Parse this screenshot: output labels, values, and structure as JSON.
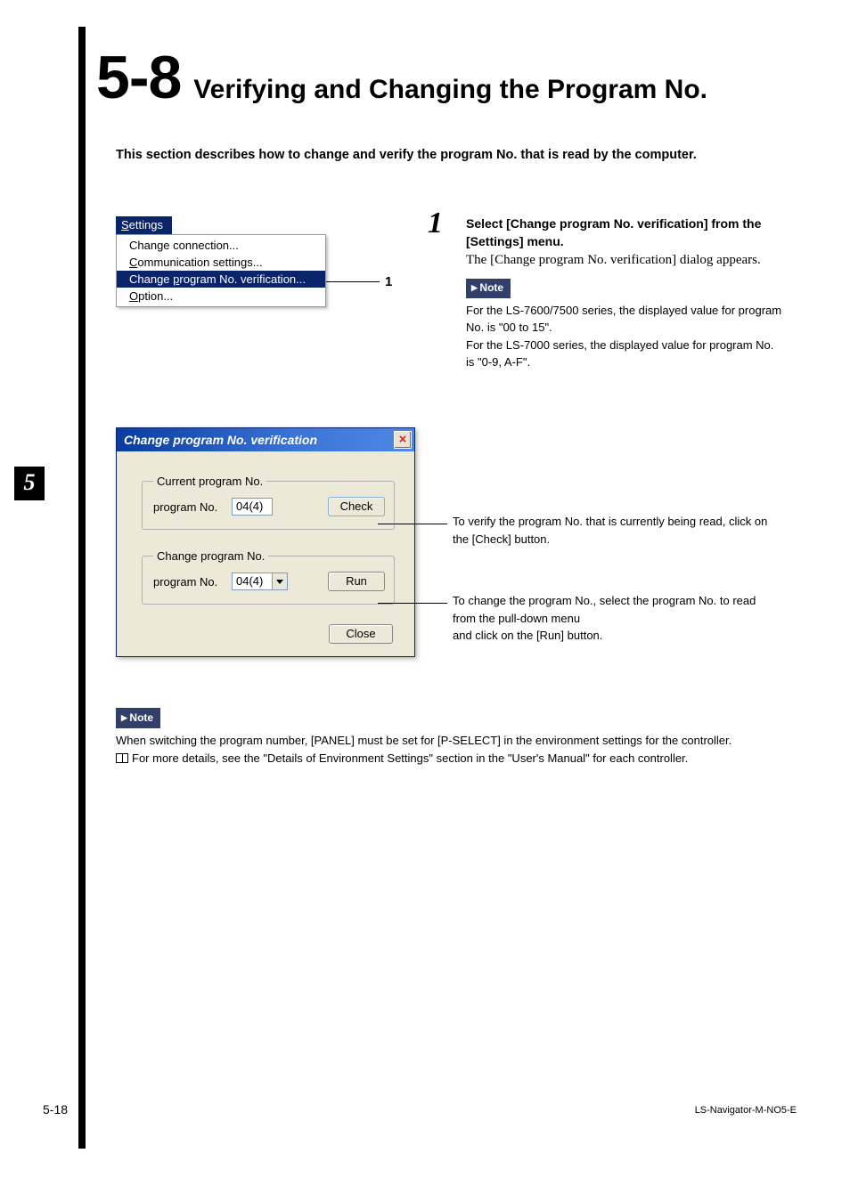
{
  "header": {
    "number": "5-8",
    "title": "Verifying and Changing the Program No."
  },
  "intro": "This section describes how to change and verify the program No. that is read by the computer.",
  "menu": {
    "title_pre_underline": "S",
    "title_rest": "ettings",
    "items": [
      {
        "pre": "Change connection...",
        "ul": "",
        "post": ""
      },
      {
        "pre": "",
        "ul": "C",
        "post": "ommunication settings..."
      },
      {
        "pre": "Change ",
        "ul": "p",
        "post": "rogram No. verification..."
      },
      {
        "pre": "",
        "ul": "O",
        "post": "ption..."
      }
    ],
    "callout": "1"
  },
  "step": {
    "number": "1",
    "title": "Select [Change program No. verification] from the [Settings] menu.",
    "body": "The [Change program No. verification] dialog appears.",
    "note_label": "Note",
    "note_body_1": "For the LS-7600/7500 series, the displayed value for program No. is \"00 to 15\".",
    "note_body_2": "For the LS-7000 series, the displayed value for program No. is \"0-9, A-F\"."
  },
  "chapter_tab": "5",
  "dialog": {
    "title": "Change program No. verification",
    "close_x": "×",
    "group1": {
      "legend": "Current program No.",
      "label": "program No.",
      "value": "04(4)",
      "button": "Check"
    },
    "group2": {
      "legend": "Change program No.",
      "label": "program No.",
      "value": "04(4)",
      "button": "Run"
    },
    "close": "Close"
  },
  "explain": {
    "check": "To verify the program No. that is currently being read, click on the [Check] button.",
    "run_l1": "To change the program No., select the program No. to read from the pull-down menu",
    "run_l2": "and click on the [Run] button."
  },
  "note2": {
    "label": "Note",
    "line1": "When switching the program number, [PANEL] must be set for [P-SELECT] in the environment settings for the controller.",
    "line2": "For more details, see the \"Details of Environment Settings\" section in the \"User's Manual\" for each controller."
  },
  "footer": {
    "left": "5-18",
    "right": "LS-Navigator-M-NO5-E"
  }
}
